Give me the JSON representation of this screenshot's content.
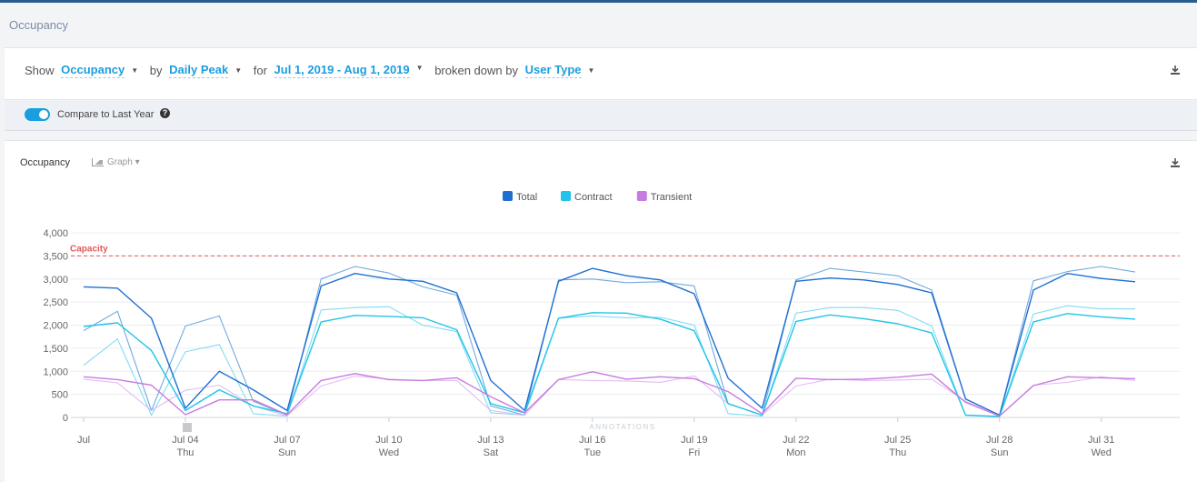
{
  "page": {
    "title": "Occupancy"
  },
  "controls": {
    "show_label": "Show",
    "metric": "Occupancy",
    "by_label": "by",
    "aggregation": "Daily Peak",
    "for_label": "for",
    "date_range": "Jul 1, 2019 - Aug 1, 2019",
    "breakdown_label": "broken down by",
    "breakdown": "User Type",
    "download_icon": "download-icon"
  },
  "compare": {
    "label": "Compare to Last Year",
    "enabled": true,
    "help_icon": "question-circle-icon"
  },
  "card": {
    "title": "Occupancy",
    "view_toggle": "Graph",
    "download_icon": "download-icon"
  },
  "chart_data": {
    "type": "line",
    "title": "",
    "xlabel": "",
    "ylabel": "",
    "ylim": [
      0,
      4000
    ],
    "yticks": [
      "0",
      "500",
      "1,000",
      "1,500",
      "2,000",
      "2,500",
      "3,000",
      "3,500",
      "4,000"
    ],
    "ytick_values": [
      0,
      500,
      1000,
      1500,
      2000,
      2500,
      3000,
      3500,
      4000
    ],
    "x": [
      1,
      2,
      3,
      4,
      5,
      6,
      7,
      8,
      9,
      10,
      11,
      12,
      13,
      14,
      15,
      16,
      17,
      18,
      19,
      20,
      21,
      22,
      23,
      24,
      25,
      26,
      27,
      28,
      29,
      30,
      31,
      32
    ],
    "xtick_labels": [
      {
        "x": 1,
        "date": "Jul",
        "day": ""
      },
      {
        "x": 4,
        "date": "Jul 04",
        "day": "Thu"
      },
      {
        "x": 7,
        "date": "Jul 07",
        "day": "Sun"
      },
      {
        "x": 10,
        "date": "Jul 10",
        "day": "Wed"
      },
      {
        "x": 13,
        "date": "Jul 13",
        "day": "Sat"
      },
      {
        "x": 16,
        "date": "Jul 16",
        "day": "Tue"
      },
      {
        "x": 19,
        "date": "Jul 19",
        "day": "Fri"
      },
      {
        "x": 22,
        "date": "Jul 22",
        "day": "Mon"
      },
      {
        "x": 25,
        "date": "Jul 25",
        "day": "Thu"
      },
      {
        "x": 28,
        "date": "Jul 28",
        "day": "Sun"
      },
      {
        "x": 31,
        "date": "Jul 31",
        "day": "Wed"
      }
    ],
    "capacity": {
      "label": "Capacity",
      "value": 3500,
      "color": "#e05a5a"
    },
    "legend": {
      "position": "top-center"
    },
    "annotations_label": "ANNOTATIONS",
    "grid": true,
    "series": [
      {
        "name": "Total",
        "color": "#1f6fd1",
        "values": [
          2830,
          2800,
          2150,
          200,
          1000,
          600,
          150,
          2850,
          3120,
          3000,
          2950,
          2700,
          800,
          150,
          2950,
          3230,
          3070,
          2980,
          2680,
          850,
          200,
          2950,
          3020,
          2980,
          2880,
          2700,
          400,
          50,
          2760,
          3120,
          3010,
          2940
        ]
      },
      {
        "name": "Contract",
        "color": "#21c4e8",
        "values": [
          1970,
          2050,
          1450,
          150,
          600,
          250,
          80,
          2070,
          2210,
          2190,
          2160,
          1900,
          300,
          100,
          2150,
          2270,
          2260,
          2130,
          1880,
          300,
          50,
          2080,
          2220,
          2140,
          2030,
          1830,
          50,
          20,
          2070,
          2250,
          2180,
          2130
        ]
      },
      {
        "name": "Transient",
        "color": "#c77be0",
        "values": [
          880,
          820,
          700,
          60,
          380,
          380,
          60,
          800,
          950,
          820,
          800,
          860,
          450,
          100,
          820,
          990,
          830,
          880,
          840,
          560,
          80,
          850,
          820,
          830,
          870,
          940,
          330,
          30,
          690,
          880,
          860,
          840
        ]
      }
    ],
    "comparison_series": [
      {
        "name": "Total",
        "color": "#4f93d6",
        "values": [
          1880,
          2300,
          150,
          1980,
          2200,
          350,
          50,
          3000,
          3270,
          3130,
          2830,
          2650,
          250,
          50,
          2980,
          3000,
          2920,
          2940,
          2850,
          300,
          50,
          2980,
          3230,
          3150,
          3070,
          2760,
          400,
          50,
          2960,
          3160,
          3270,
          3150
        ]
      },
      {
        "name": "Contract",
        "color": "#62d5ee",
        "values": [
          1130,
          1700,
          50,
          1420,
          1580,
          80,
          30,
          2330,
          2380,
          2400,
          2000,
          1860,
          100,
          50,
          2150,
          2200,
          2160,
          2170,
          2000,
          80,
          30,
          2260,
          2380,
          2380,
          2320,
          1980,
          50,
          20,
          2240,
          2420,
          2350,
          2350
        ]
      },
      {
        "name": "Transient",
        "color": "#dcadef",
        "values": [
          830,
          750,
          150,
          590,
          700,
          250,
          30,
          680,
          900,
          830,
          800,
          800,
          150,
          50,
          820,
          800,
          790,
          760,
          900,
          300,
          50,
          680,
          830,
          800,
          810,
          830,
          350,
          30,
          700,
          760,
          880,
          800
        ]
      }
    ]
  }
}
